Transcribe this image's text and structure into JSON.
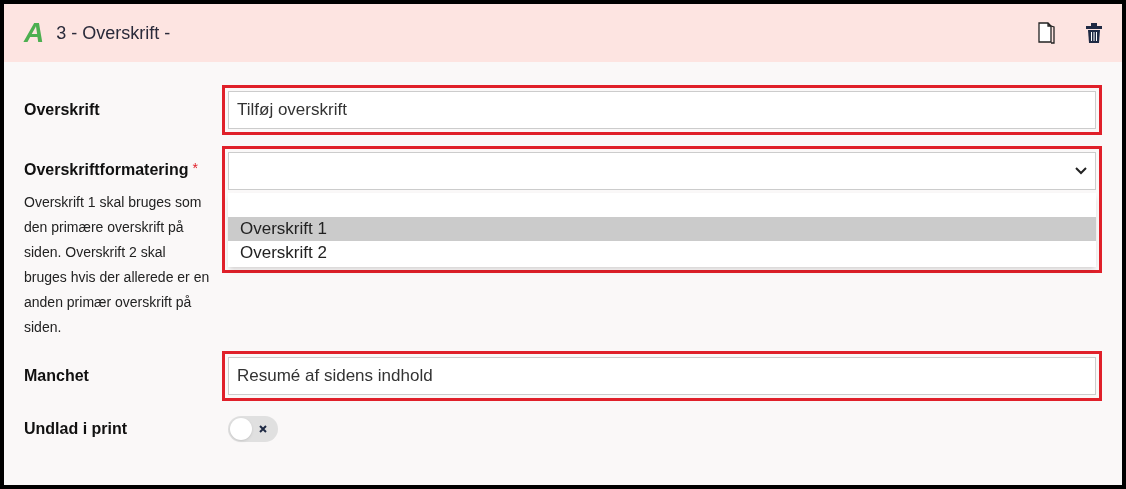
{
  "header": {
    "title": "3 - Overskrift -",
    "logo_letter": "A"
  },
  "fields": [
    {
      "kind": "text",
      "label": "Overskrift",
      "placeholder": "Tilføj overskrift",
      "highlighted": true
    },
    {
      "kind": "select",
      "label": "Overskriftformatering",
      "required": true,
      "required_mark": "*",
      "help": "Overskrift 1 skal bruges som den primære overskrift på siden. Overskrift 2 skal bruges hvis der allerede er en anden primær overskrift på siden.",
      "highlighted": true,
      "expanded": true,
      "options": [
        {
          "label": "Overskrift 1",
          "selected": true
        },
        {
          "label": "Overskrift 2",
          "selected": false
        }
      ]
    },
    {
      "kind": "text",
      "label": "Manchet",
      "placeholder": "Resumé af sidens indhold",
      "highlighted": true
    },
    {
      "kind": "toggle",
      "label": "Undlad i print",
      "on": false
    }
  ]
}
